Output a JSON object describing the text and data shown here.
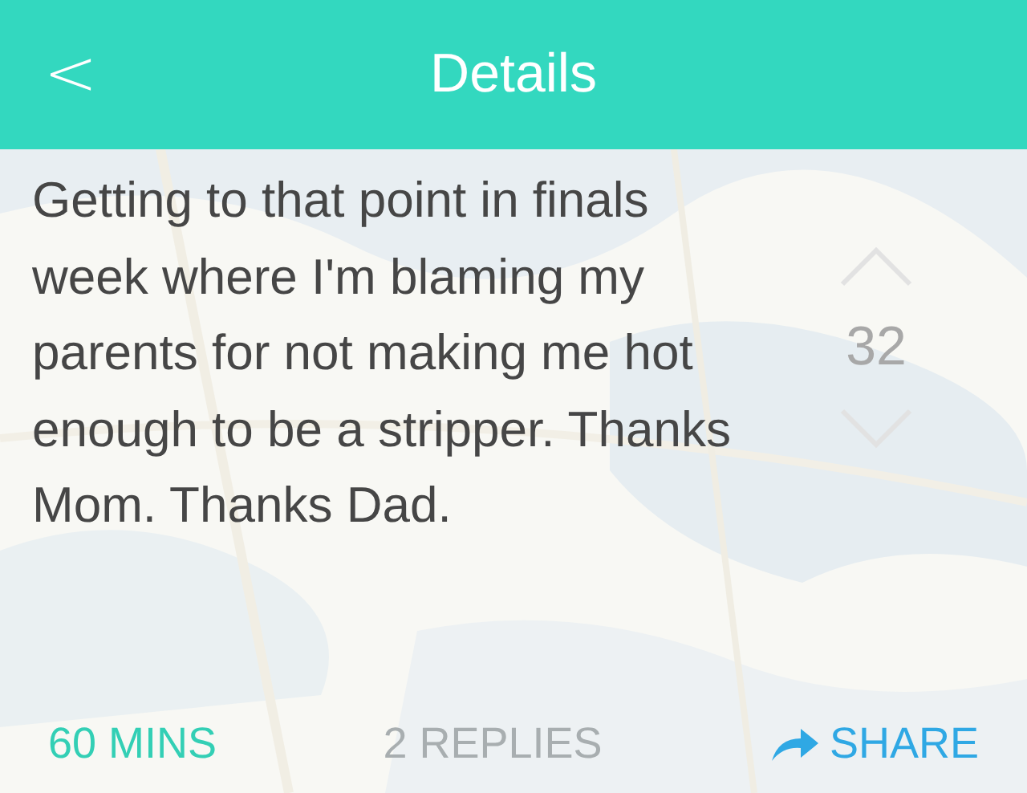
{
  "header": {
    "title": "Details",
    "back": "<"
  },
  "post": {
    "text": "Getting to that point in finals week where I'm blaming my parents for not making me hot enough to be a stripper. Thanks Mom. Thanks Dad.",
    "votes": "32"
  },
  "footer": {
    "time": "60 MINS",
    "replies": "2 REPLIES",
    "share": "SHARE"
  }
}
